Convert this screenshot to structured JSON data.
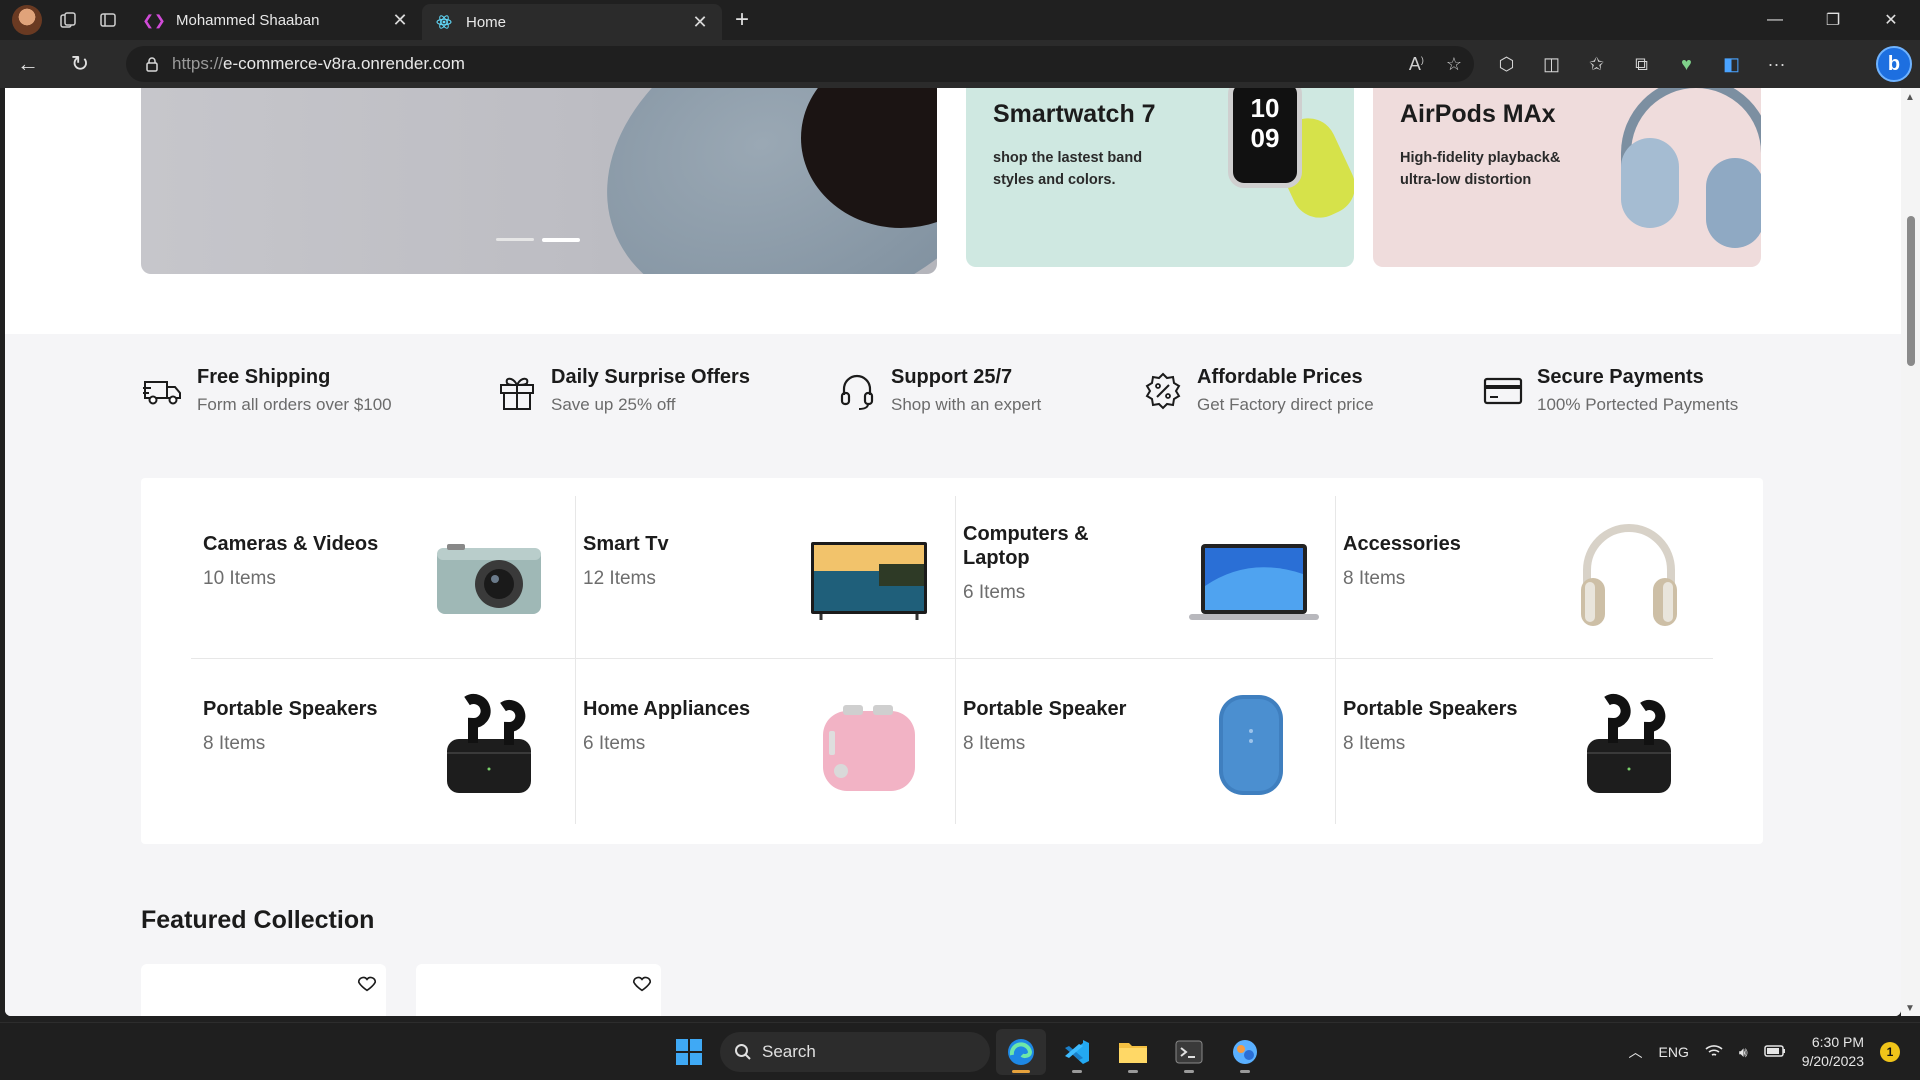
{
  "browser": {
    "tabs": [
      {
        "title": "Mohammed Shaaban",
        "active": false
      },
      {
        "title": "Home",
        "active": true
      }
    ],
    "url_proto": "https://",
    "url_host": "e-commerce-v8ra.onrender.com"
  },
  "hero": {
    "slides_count": 2,
    "active_slide": 2,
    "promos": [
      {
        "title": "Smartwatch 7",
        "desc": "shop the lastest band styles and colors.",
        "watch_time": [
          "10",
          "09"
        ]
      },
      {
        "title": "AirPods MAx",
        "desc": "High-fidelity playback& ultra-low distortion"
      }
    ]
  },
  "services": [
    {
      "title": "Free Shipping",
      "subtitle": "Form all orders over $100",
      "icon": "truck-icon"
    },
    {
      "title": "Daily Surprise Offers",
      "subtitle": "Save up 25% off",
      "icon": "gift-icon"
    },
    {
      "title": "Support 25/7",
      "subtitle": "Shop with an expert",
      "icon": "headset-icon"
    },
    {
      "title": "Affordable Prices",
      "subtitle": "Get Factory direct price",
      "icon": "discount-badge-icon"
    },
    {
      "title": "Secure Payments",
      "subtitle": "100% Portected Payments",
      "icon": "credit-card-icon"
    }
  ],
  "categories": [
    {
      "name": "Cameras & Videos",
      "count": "10 Items",
      "image": "camera"
    },
    {
      "name": "Smart Tv",
      "count": "12 Items",
      "image": "tv"
    },
    {
      "name": "Computers & Laptop",
      "count": "6 Items",
      "image": "laptop"
    },
    {
      "name": "Accessories",
      "count": "8 Items",
      "image": "headphones"
    },
    {
      "name": "Portable Speakers",
      "count": "8 Items",
      "image": "earbuds"
    },
    {
      "name": "Home Appliances",
      "count": "6 Items",
      "image": "toaster"
    },
    {
      "name": "Portable Speaker",
      "count": "8 Items",
      "image": "smart-speaker"
    },
    {
      "name": "Portable Speakers",
      "count": "8 Items",
      "image": "earbuds"
    }
  ],
  "featured": {
    "title": "Featured Collection"
  },
  "taskbar": {
    "search_label": "Search",
    "language": "ENG",
    "time": "6:30 PM",
    "date": "9/20/2023",
    "notification_count": "1"
  }
}
